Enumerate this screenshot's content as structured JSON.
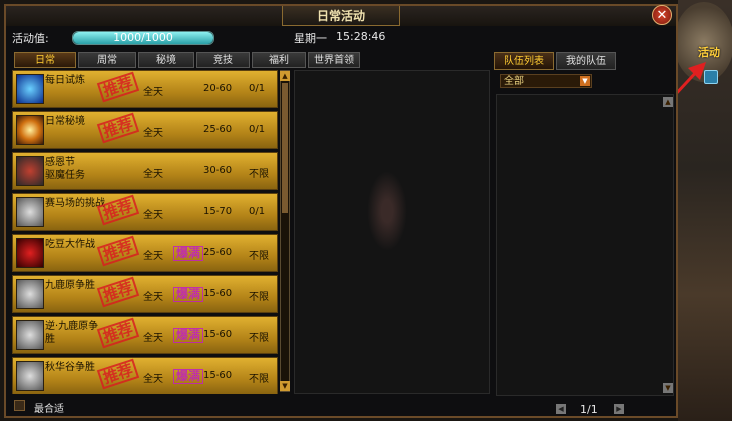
{
  "window": {
    "title": "日常活动",
    "close_label": "✕"
  },
  "activity": {
    "label": "活动值:",
    "value": "1000/1000",
    "progress": 1.0
  },
  "clock": {
    "weekday": "星期一",
    "time": "15:28:46"
  },
  "tabs": [
    {
      "label": "日常",
      "active": true
    },
    {
      "label": "周常",
      "active": false
    },
    {
      "label": "秘境",
      "active": false
    },
    {
      "label": "竞技",
      "active": false
    },
    {
      "label": "福利",
      "active": false
    },
    {
      "label": "世界首领",
      "active": false
    }
  ],
  "activities": [
    {
      "name": "每日试炼",
      "time": "全天",
      "level": "20-60",
      "count": "0/1",
      "recommended": true,
      "hot": false,
      "icon": "blue-rune-icon"
    },
    {
      "name": "日常秘境",
      "time": "全天",
      "level": "25-60",
      "count": "0/1",
      "recommended": true,
      "hot": false,
      "icon": "flame-icon"
    },
    {
      "name": "感恩节\n驱魔任务",
      "time": "全天",
      "level": "30-60",
      "count": "不限",
      "recommended": false,
      "hot": false,
      "icon": "rider-icon"
    },
    {
      "name": "赛马场的挑战",
      "time": "全天",
      "level": "15-70",
      "count": "0/1",
      "recommended": true,
      "hot": false,
      "icon": "horse-icon"
    },
    {
      "name": "吃豆大作战",
      "time": "全天",
      "level": "25-60",
      "count": "不限",
      "recommended": true,
      "hot": true,
      "icon": "pacman-icon"
    },
    {
      "name": "九鹿原争胜",
      "time": "全天",
      "level": "15-60",
      "count": "不限",
      "recommended": true,
      "hot": true,
      "icon": "horse-icon"
    },
    {
      "name": "逆·九鹿原争\n胜",
      "time": "全天",
      "level": "15-60",
      "count": "不限",
      "recommended": true,
      "hot": true,
      "icon": "horse-icon"
    },
    {
      "name": "秋华谷争胜",
      "time": "全天",
      "level": "15-60",
      "count": "不限",
      "recommended": true,
      "hot": true,
      "icon": "horse-icon"
    }
  ],
  "stamps": {
    "recommend": "推荐",
    "hot": "爆满"
  },
  "team": {
    "tabs": [
      {
        "label": "队伍列表",
        "active": true
      },
      {
        "label": "我的队伍",
        "active": false
      }
    ],
    "filter": "全部",
    "page": "1/1"
  },
  "bottom": {
    "checkbox_label": "最合适"
  },
  "side": {
    "activity_button": "活动"
  },
  "colors": {
    "gold": "#e0b030",
    "accent": "#ffcc33",
    "stamp_red": "#d82020",
    "stamp_purple": "#c020c0"
  }
}
